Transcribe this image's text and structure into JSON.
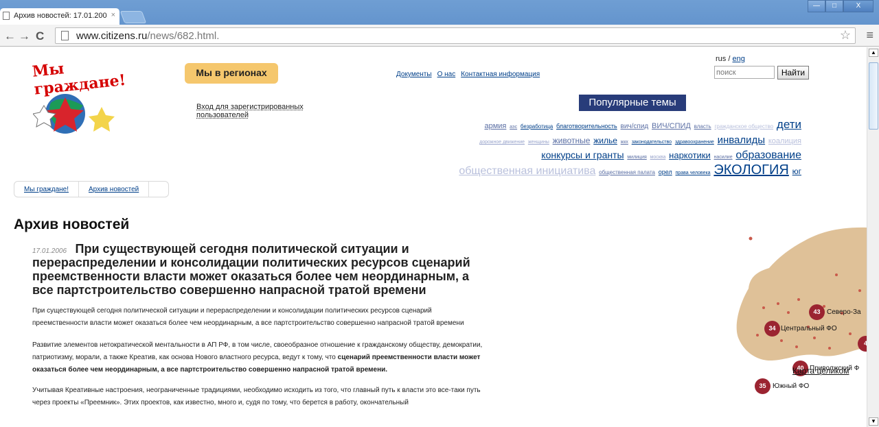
{
  "browser": {
    "tab_title": "Архив новостей: 17.01.200",
    "tab_close": "×",
    "window_buttons": [
      "—",
      "□",
      "X"
    ],
    "nav": {
      "back": "←",
      "forward": "→",
      "reload": "C"
    },
    "url_host": "www.citizens.ru",
    "url_path": "/news/682.html.",
    "star": "☆",
    "menu": "≡"
  },
  "header": {
    "logo_text": "Мы граждане!",
    "regions_label": "Мы в регионах",
    "login_link": "Вход для зарегистрированных пользователей",
    "topnav": [
      "Документы",
      "О нас",
      "Контактная информация"
    ],
    "lang": {
      "ru": "rus",
      "sep": "/",
      "en": "eng"
    },
    "search_placeholder": "поиск",
    "search_button": "Найти"
  },
  "popular": {
    "title": "Популярные темы",
    "tags": [
      {
        "label": "армия",
        "size": 11,
        "color": "#5b6fa4"
      },
      {
        "label": "аэс",
        "size": 7,
        "color": "#5b6fa4"
      },
      {
        "label": "безработица",
        "size": 8,
        "color": "#003f89"
      },
      {
        "label": "благотворительность",
        "size": 9,
        "color": "#003f89"
      },
      {
        "label": "вич/спид",
        "size": 10,
        "color": "#5b6fa4"
      },
      {
        "label": "ВИЧ/СПИД",
        "size": 11,
        "color": "#5b6fa4"
      },
      {
        "label": "власть",
        "size": 8,
        "color": "#5b6fa4"
      },
      {
        "label": "гражданское общество",
        "size": 8,
        "color": "#b9c0dc"
      },
      {
        "label": "дети",
        "size": 17,
        "color": "#003f89"
      },
      {
        "label": "дорожное движение",
        "size": 7,
        "color": "#9aa5cc"
      },
      {
        "label": "женщины",
        "size": 7,
        "color": "#9aa5cc"
      },
      {
        "label": "животные",
        "size": 12,
        "color": "#5b6fa4"
      },
      {
        "label": "жилье",
        "size": 12,
        "color": "#003f89"
      },
      {
        "label": "жкх",
        "size": 7,
        "color": "#5b6fa4"
      },
      {
        "label": "законодательство",
        "size": 7,
        "color": "#003f89"
      },
      {
        "label": "здравоохранение",
        "size": 7,
        "color": "#003f89"
      },
      {
        "label": "инвалиды",
        "size": 15,
        "color": "#003f89"
      },
      {
        "label": "коалиция",
        "size": 11,
        "color": "#b9c0dc"
      },
      {
        "label": "конкурсы и гранты",
        "size": 14,
        "color": "#003f89"
      },
      {
        "label": "милиция",
        "size": 7,
        "color": "#5b6fa4"
      },
      {
        "label": "москва",
        "size": 7,
        "color": "#9aa5cc"
      },
      {
        "label": "наркотики",
        "size": 13,
        "color": "#003f89"
      },
      {
        "label": "насилие",
        "size": 7,
        "color": "#5b6fa4"
      },
      {
        "label": "образование",
        "size": 16,
        "color": "#003f89"
      },
      {
        "label": "общественная инициатива",
        "size": 16,
        "color": "#b9c0dc"
      },
      {
        "label": "общественная палата",
        "size": 8,
        "color": "#5b6fa4"
      },
      {
        "label": "орел",
        "size": 9,
        "color": "#003f89"
      },
      {
        "label": "права человека",
        "size": 7,
        "color": "#003f89"
      },
      {
        "label": "ЭКОЛОГИЯ",
        "size": 20,
        "color": "#003f89"
      },
      {
        "label": "юг",
        "size": 12,
        "color": "#003f89"
      }
    ]
  },
  "breadcrumb": [
    "Мы граждане!",
    "Архив новостей"
  ],
  "page": {
    "title": "Архив новостей",
    "date": "17.01.2006",
    "headline": "При существующей сегодня политической ситуации и перераспределении и консолидации политических ресурсов сценарий преемственности власти может оказаться более чем неординарным, а все партстроительство совершенно напрасной тратой времени",
    "p1": "При существующей сегодня политической ситуации и перераспределении и консолидации политических ресурсов сценарий преемственности власти может оказаться более чем неординарным, а все партстроительство совершенно напрасной тратой времени",
    "p2_start": "Развитие элементов нетократической ментальности в АП РФ, в том числе, своеобразное отношение к гражданскому обществу, демократии, патриотизму, морали, а также Креатив, как основа Нового властного ресурса, ведут к тому, что ",
    "p2_bold": "сценарий преемственности власти может оказаться более чем неординарным, а все партстроительство совершенно напрасной тратой времени.",
    "p3": "Учитывая Креативные настроения, неограниченные традициями, необходимо исходить из того, что главный путь к власти это все-таки путь через проекты «Преемник». Этих проектов, как известно, много и, судя по тому, что берется в работу, окончательный"
  },
  "map": {
    "regions": [
      {
        "count": "43",
        "label": "Северо-За"
      },
      {
        "count": "34",
        "label": "Центральный ФО"
      },
      {
        "count": "4",
        "label": ""
      },
      {
        "count": "40",
        "label": "Приволжский Ф"
      },
      {
        "count": "35",
        "label": "Южный ФО"
      }
    ],
    "link": "Карта целиком"
  }
}
